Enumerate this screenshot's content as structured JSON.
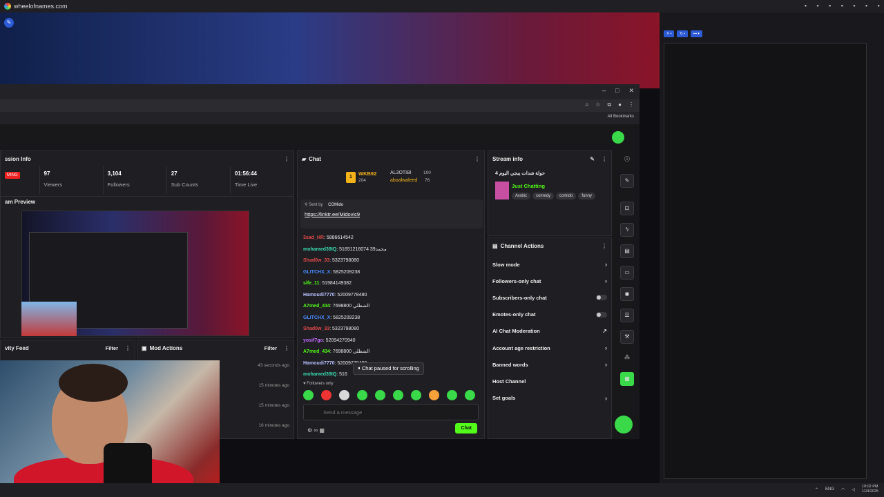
{
  "browser": {
    "url": "wheelofnames.com",
    "bookmarks_label": "All Bookmarks"
  },
  "session": {
    "title": "ssion Info",
    "live_badge": "MING",
    "stats": [
      {
        "value": "97",
        "label": "Viewers"
      },
      {
        "value": "3,104",
        "label": "Followers"
      },
      {
        "value": "27",
        "label": "Sub Counts"
      },
      {
        "value": "01:56:44",
        "label": "Time Live"
      }
    ]
  },
  "preview": {
    "title": "am Preview"
  },
  "activity": {
    "title": "vity Feed",
    "filter": "Filter"
  },
  "mod_actions": {
    "title": "Mod Actions",
    "filter": "Filter",
    "rows": [
      "43 seconds ago",
      "15 minutes ago",
      "15 minutes ago",
      "16 minutes ago"
    ]
  },
  "chat": {
    "title": "Chat",
    "leaderboard": [
      {
        "name": "WKB92",
        "points": "204"
      },
      {
        "name": "AL3OTIBI",
        "points": "100"
      },
      {
        "name": "aboalwaleed",
        "points": "76"
      }
    ],
    "rank": "1",
    "pinned": {
      "sent_by": "Sent by",
      "sender": "COMido",
      "link": "https://linktr.ee/Midovic9"
    },
    "messages": [
      {
        "user": "3sad_HR",
        "text": ": 5886614542",
        "color": "#e04848"
      },
      {
        "user": "mohamed39IQ",
        "text": ": 51651216074 39محمد",
        "color": "#3ad9b0"
      },
      {
        "user": "Shad0w_33",
        "text": ": 5323798080",
        "color": "#e04848"
      },
      {
        "user": "GLITCHX_X",
        "text": ": 5825209238",
        "color": "#4a8cff"
      },
      {
        "user": "sife_11",
        "text": ": 51984149382",
        "color": "#53fc18"
      },
      {
        "user": "Hamoudi7770",
        "text": ": 52009778480",
        "color": "#b8c0ff"
      },
      {
        "user": "A7med_434",
        "text": ": 7698800 الشطلي",
        "color": "#53fc18"
      },
      {
        "user": "GLITCHX_X",
        "text": ": 5825209238",
        "color": "#4a8cff"
      },
      {
        "user": "Shad0w_33",
        "text": ": 5323798080",
        "color": "#e04848"
      },
      {
        "user": "yosif7go",
        "text": ": 52094270940",
        "color": "#c36bff"
      },
      {
        "user": "A7med_434",
        "text": ": 7698800 الشطلي",
        "color": "#53fc18"
      },
      {
        "user": "Hamoudi7770",
        "text": ": 52009778480",
        "color": "#b8c0ff"
      },
      {
        "user": "mohamed39IQ",
        "text": ": 516",
        "color": "#3ad9b0"
      }
    ],
    "paused": "Chat paused for scrolling",
    "followers_only": "Followers only",
    "placeholder": "Send a message",
    "send": "Chat"
  },
  "stream_info": {
    "title": "Stream info",
    "stream_title": "4 حولة شدات يبجي اليوم",
    "category": "Just Chatting",
    "tags": [
      "Arabic",
      "comedy",
      "comido",
      "funny"
    ]
  },
  "channel_actions": {
    "title": "Channel Actions",
    "items": [
      {
        "label": "Slow mode",
        "control": "›"
      },
      {
        "label": "Followers-only chat",
        "control": "›"
      },
      {
        "label": "Subscribers-only chat",
        "control": "toggle"
      },
      {
        "label": "Emotes-only chat",
        "control": "toggle"
      },
      {
        "label": "AI Chat Moderation",
        "control": "↗"
      },
      {
        "label": "Account age restriction",
        "control": "›"
      },
      {
        "label": "Banned words",
        "control": "›"
      },
      {
        "label": "Host Channel",
        "control": ""
      },
      {
        "label": "Set goals",
        "control": "›"
      }
    ]
  },
  "taskbar": {
    "lang": "ENG",
    "time": "10:02 PM",
    "date": "11/4/2025"
  },
  "colors": {
    "accent": "#53fc18",
    "live": "#e22222"
  }
}
